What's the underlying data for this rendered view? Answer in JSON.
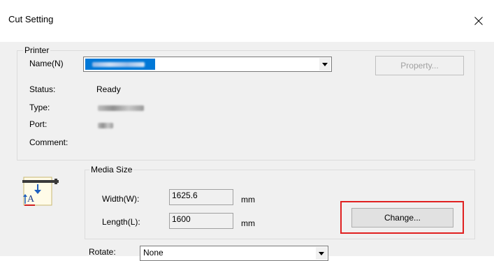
{
  "window": {
    "title": "Cut Setting"
  },
  "printer": {
    "group_label": "Printer",
    "name_label": "Name(N)",
    "property_button": "Property...",
    "status_label": "Status:",
    "status_value": "Ready",
    "type_label": "Type:",
    "port_label": "Port:",
    "comment_label": "Comment:"
  },
  "media": {
    "group_label": "Media Size",
    "width_label": "Width(W):",
    "width_value": "1625.6",
    "width_unit": "mm",
    "length_label": "Length(L):",
    "length_value": "1600",
    "length_unit": "mm",
    "change_button": "Change..."
  },
  "rotate": {
    "label": "Rotate:",
    "value": "None"
  },
  "colors": {
    "highlight": "#e02020",
    "selection": "#0078d7"
  },
  "icons": [
    "close-icon",
    "dropdown-arrow-icon",
    "media-size-icon"
  ]
}
